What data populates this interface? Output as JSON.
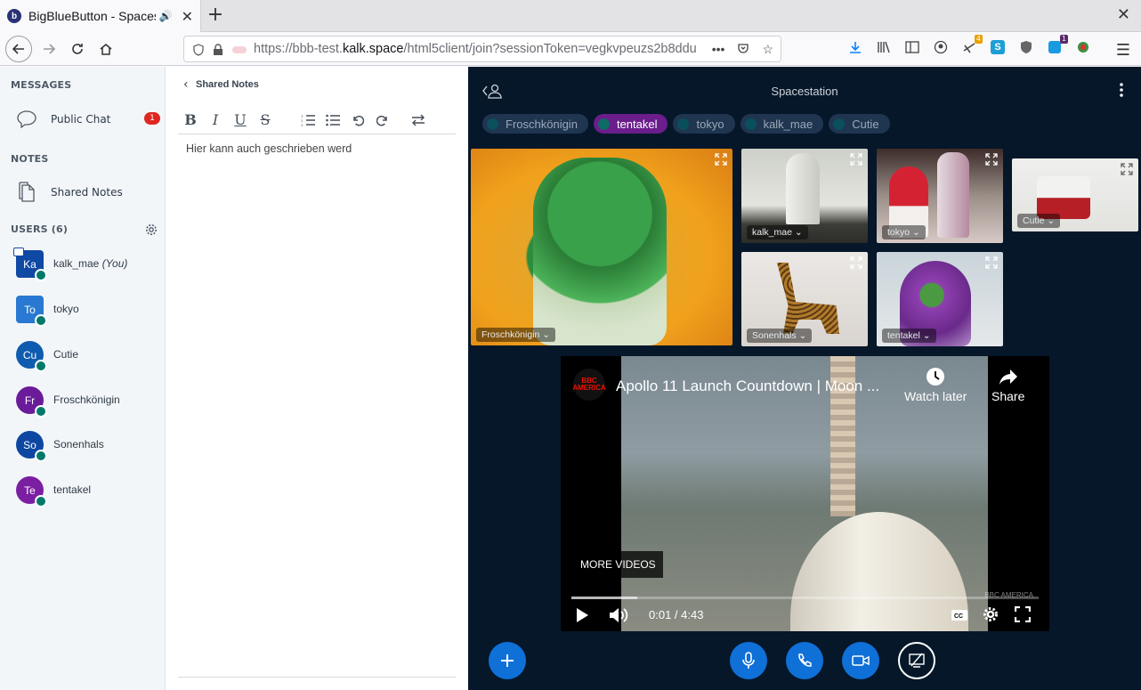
{
  "browser": {
    "tab_title": "BigBlueButton - Spacestation",
    "tab_favicon_letter": "b",
    "url_prefix": "https://bbb-test.",
    "url_domain": "kalk.space",
    "url_rest": "/html5client/join?sessionToken=vegkvpeuzs2b8ddu",
    "toolbar_badges": {
      "addon_badge": "4",
      "counter_badge": "1"
    }
  },
  "sidebar": {
    "messages_title": "MESSAGES",
    "public_chat": "Public Chat",
    "public_chat_unread": "1",
    "notes_title": "NOTES",
    "shared_notes": "Shared Notes",
    "users_title": "USERS (6)",
    "users": [
      {
        "initials": "Ka",
        "name": "kalk_mae",
        "suffix": "(You)",
        "color": "#1049a3"
      },
      {
        "initials": "To",
        "name": "tokyo",
        "suffix": "",
        "color": "#2979d2"
      },
      {
        "initials": "Cu",
        "name": "Cutie",
        "suffix": "",
        "color": "#0f5baf"
      },
      {
        "initials": "Fr",
        "name": "Froschkönigin",
        "suffix": "",
        "color": "#6a1b9a"
      },
      {
        "initials": "So",
        "name": "Sonenhals",
        "suffix": "",
        "color": "#0d47a1"
      },
      {
        "initials": "Te",
        "name": "tentakel",
        "suffix": "",
        "color": "#7b1fa2"
      }
    ]
  },
  "notes": {
    "header": "Shared Notes",
    "toolbar": [
      "B",
      "I",
      "U",
      "S"
    ],
    "content": "Hier kann auch geschrieben werd"
  },
  "main": {
    "room_title": "Spacestation",
    "talkers": [
      {
        "name": "Froschkönigin",
        "talking": false
      },
      {
        "name": "tentakel",
        "talking": true
      },
      {
        "name": "tokyo",
        "talking": false
      },
      {
        "name": "kalk_mae",
        "talking": false
      },
      {
        "name": "Cutie",
        "talking": false
      }
    ],
    "videos": {
      "frosch": "Froschkönigin",
      "kalk": "kalk_mae",
      "tokyo": "tokyo",
      "cutie": "Cutie",
      "sonenhals": "Sonenhals",
      "tentakel": "tentakel"
    },
    "youtube": {
      "channel_logo": "BBC AMERICA",
      "title": "Apollo 11 Launch Countdown | Moon ...",
      "watch_later": "Watch later",
      "share": "Share",
      "more_videos": "MORE VIDEOS",
      "time": "0:01 / 4:43",
      "progress_fraction": 0.14,
      "watermark": "BBC AMERICA"
    }
  },
  "colors": {
    "accent": "#0f70d7",
    "talking": "#6b1d8c",
    "badge_red": "#df2721",
    "main_bg": "#06172a"
  }
}
